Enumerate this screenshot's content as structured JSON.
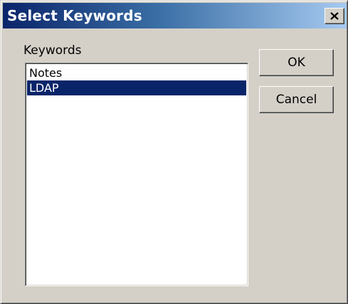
{
  "window": {
    "title": "Select Keywords"
  },
  "keywords": {
    "label": "Keywords",
    "items": [
      {
        "label": "Notes",
        "selected": false
      },
      {
        "label": "LDAP",
        "selected": true
      }
    ]
  },
  "buttons": {
    "ok_label": "OK",
    "cancel_label": "Cancel"
  },
  "icons": {
    "close": "close-icon"
  },
  "colors": {
    "title_bar_start": "#0a246a",
    "title_bar_end": "#a6caf0",
    "dialog_face": "#d4d0c8",
    "selection": "#0a246a"
  }
}
